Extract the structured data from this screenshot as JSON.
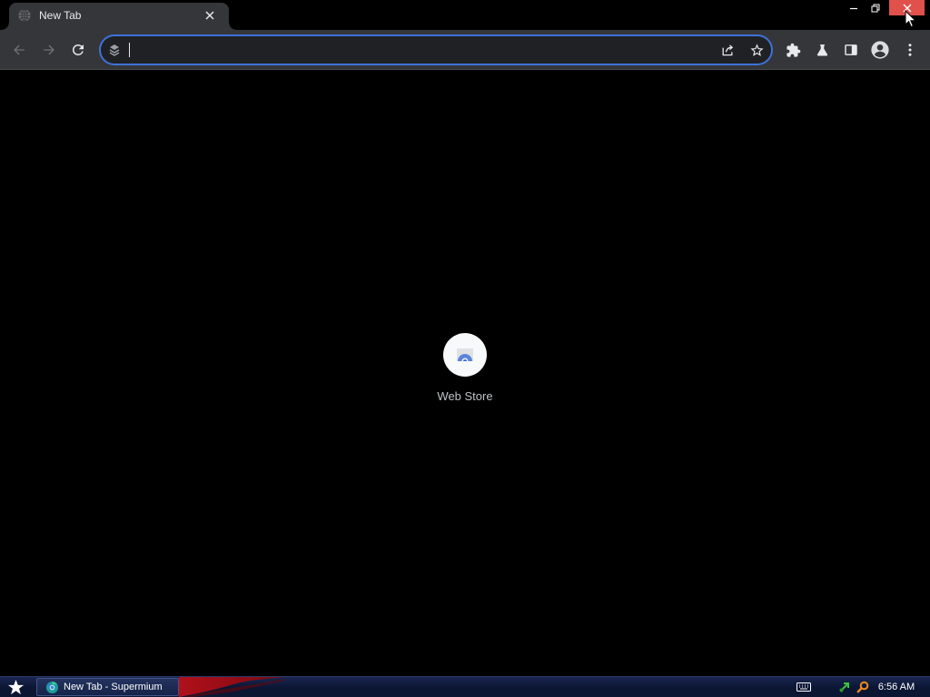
{
  "window": {
    "controls": {
      "minimize": {
        "icon": "minimize-icon"
      },
      "restore": {
        "icon": "restore-icon"
      },
      "close": {
        "icon": "close-icon",
        "hovered": true
      }
    }
  },
  "tabs": [
    {
      "title": "New Tab",
      "favicon": "globe-icon",
      "active": true,
      "close_icon": "close-icon"
    }
  ],
  "toolbar": {
    "back": {
      "icon": "back-arrow-icon",
      "disabled": true
    },
    "forward": {
      "icon": "forward-arrow-icon",
      "disabled": true
    },
    "reload": {
      "icon": "reload-icon",
      "disabled": false
    },
    "omnibox": {
      "value": "",
      "focused": true,
      "leading_icon": "search-engine-icon",
      "page_actions": [
        {
          "icon": "share-icon"
        },
        {
          "icon": "bookmark-star-icon"
        }
      ]
    },
    "actions": [
      {
        "icon": "extensions-puzzle-icon"
      },
      {
        "icon": "chrome-labs-flask-icon"
      },
      {
        "icon": "side-panel-icon"
      },
      {
        "icon": "profile-avatar-icon"
      },
      {
        "icon": "menu-kebab-icon"
      }
    ]
  },
  "new_tab_page": {
    "shortcuts": [
      {
        "label": "Web Store",
        "icon": "web-store-icon"
      }
    ]
  },
  "taskbar": {
    "start_icon": "start-star-icon",
    "tasks": [
      {
        "label": "New Tab - Supermium",
        "icon": "supermium-icon",
        "active": true
      }
    ],
    "tray_icons": [
      "keyboard-icon",
      "network-icon",
      "search-icon"
    ],
    "clock": "6:56 AM"
  },
  "colors": {
    "tabstrip": "#000000",
    "toolbar": "#35363a",
    "omnibox": "#202124",
    "focus_ring": "#3d72d9",
    "content": "#000000",
    "close_hover": "#e0514c",
    "taskbar": "#0b1633",
    "text": "#e8eaed",
    "muted_text": "#bdc1c6",
    "icon": "#e8eaed",
    "icon_disabled": "#6e7175"
  }
}
